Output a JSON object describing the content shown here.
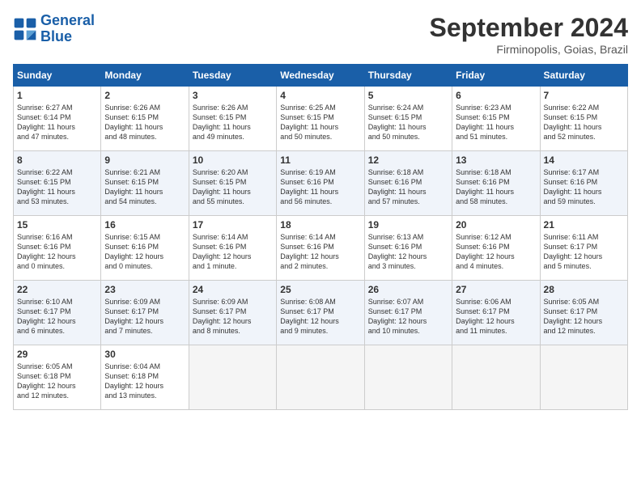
{
  "header": {
    "logo_line1": "General",
    "logo_line2": "Blue",
    "month": "September 2024",
    "location": "Firminopolis, Goias, Brazil"
  },
  "columns": [
    "Sunday",
    "Monday",
    "Tuesday",
    "Wednesday",
    "Thursday",
    "Friday",
    "Saturday"
  ],
  "rows": [
    [
      {
        "day": "1",
        "text": "Sunrise: 6:27 AM\nSunset: 6:14 PM\nDaylight: 11 hours\nand 47 minutes."
      },
      {
        "day": "2",
        "text": "Sunrise: 6:26 AM\nSunset: 6:15 PM\nDaylight: 11 hours\nand 48 minutes."
      },
      {
        "day": "3",
        "text": "Sunrise: 6:26 AM\nSunset: 6:15 PM\nDaylight: 11 hours\nand 49 minutes."
      },
      {
        "day": "4",
        "text": "Sunrise: 6:25 AM\nSunset: 6:15 PM\nDaylight: 11 hours\nand 50 minutes."
      },
      {
        "day": "5",
        "text": "Sunrise: 6:24 AM\nSunset: 6:15 PM\nDaylight: 11 hours\nand 50 minutes."
      },
      {
        "day": "6",
        "text": "Sunrise: 6:23 AM\nSunset: 6:15 PM\nDaylight: 11 hours\nand 51 minutes."
      },
      {
        "day": "7",
        "text": "Sunrise: 6:22 AM\nSunset: 6:15 PM\nDaylight: 11 hours\nand 52 minutes."
      }
    ],
    [
      {
        "day": "8",
        "text": "Sunrise: 6:22 AM\nSunset: 6:15 PM\nDaylight: 11 hours\nand 53 minutes."
      },
      {
        "day": "9",
        "text": "Sunrise: 6:21 AM\nSunset: 6:15 PM\nDaylight: 11 hours\nand 54 minutes."
      },
      {
        "day": "10",
        "text": "Sunrise: 6:20 AM\nSunset: 6:15 PM\nDaylight: 11 hours\nand 55 minutes."
      },
      {
        "day": "11",
        "text": "Sunrise: 6:19 AM\nSunset: 6:16 PM\nDaylight: 11 hours\nand 56 minutes."
      },
      {
        "day": "12",
        "text": "Sunrise: 6:18 AM\nSunset: 6:16 PM\nDaylight: 11 hours\nand 57 minutes."
      },
      {
        "day": "13",
        "text": "Sunrise: 6:18 AM\nSunset: 6:16 PM\nDaylight: 11 hours\nand 58 minutes."
      },
      {
        "day": "14",
        "text": "Sunrise: 6:17 AM\nSunset: 6:16 PM\nDaylight: 11 hours\nand 59 minutes."
      }
    ],
    [
      {
        "day": "15",
        "text": "Sunrise: 6:16 AM\nSunset: 6:16 PM\nDaylight: 12 hours\nand 0 minutes."
      },
      {
        "day": "16",
        "text": "Sunrise: 6:15 AM\nSunset: 6:16 PM\nDaylight: 12 hours\nand 0 minutes."
      },
      {
        "day": "17",
        "text": "Sunrise: 6:14 AM\nSunset: 6:16 PM\nDaylight: 12 hours\nand 1 minute."
      },
      {
        "day": "18",
        "text": "Sunrise: 6:14 AM\nSunset: 6:16 PM\nDaylight: 12 hours\nand 2 minutes."
      },
      {
        "day": "19",
        "text": "Sunrise: 6:13 AM\nSunset: 6:16 PM\nDaylight: 12 hours\nand 3 minutes."
      },
      {
        "day": "20",
        "text": "Sunrise: 6:12 AM\nSunset: 6:16 PM\nDaylight: 12 hours\nand 4 minutes."
      },
      {
        "day": "21",
        "text": "Sunrise: 6:11 AM\nSunset: 6:17 PM\nDaylight: 12 hours\nand 5 minutes."
      }
    ],
    [
      {
        "day": "22",
        "text": "Sunrise: 6:10 AM\nSunset: 6:17 PM\nDaylight: 12 hours\nand 6 minutes."
      },
      {
        "day": "23",
        "text": "Sunrise: 6:09 AM\nSunset: 6:17 PM\nDaylight: 12 hours\nand 7 minutes."
      },
      {
        "day": "24",
        "text": "Sunrise: 6:09 AM\nSunset: 6:17 PM\nDaylight: 12 hours\nand 8 minutes."
      },
      {
        "day": "25",
        "text": "Sunrise: 6:08 AM\nSunset: 6:17 PM\nDaylight: 12 hours\nand 9 minutes."
      },
      {
        "day": "26",
        "text": "Sunrise: 6:07 AM\nSunset: 6:17 PM\nDaylight: 12 hours\nand 10 minutes."
      },
      {
        "day": "27",
        "text": "Sunrise: 6:06 AM\nSunset: 6:17 PM\nDaylight: 12 hours\nand 11 minutes."
      },
      {
        "day": "28",
        "text": "Sunrise: 6:05 AM\nSunset: 6:17 PM\nDaylight: 12 hours\nand 12 minutes."
      }
    ],
    [
      {
        "day": "29",
        "text": "Sunrise: 6:05 AM\nSunset: 6:18 PM\nDaylight: 12 hours\nand 12 minutes."
      },
      {
        "day": "30",
        "text": "Sunrise: 6:04 AM\nSunset: 6:18 PM\nDaylight: 12 hours\nand 13 minutes."
      },
      {
        "day": "",
        "text": ""
      },
      {
        "day": "",
        "text": ""
      },
      {
        "day": "",
        "text": ""
      },
      {
        "day": "",
        "text": ""
      },
      {
        "day": "",
        "text": ""
      }
    ]
  ]
}
